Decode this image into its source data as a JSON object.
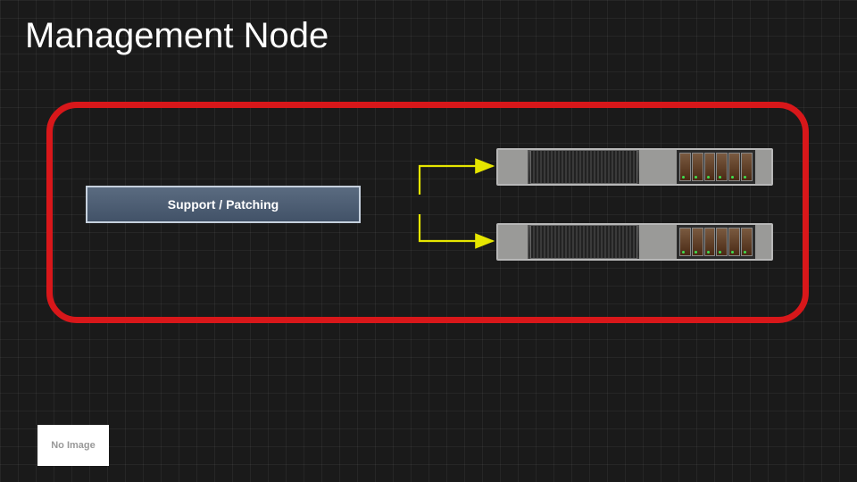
{
  "title": "Management Node",
  "box_label": "Support / Patching",
  "no_image_text": "No\nImage",
  "colors": {
    "background": "#1a1a1a",
    "border": "#d8171a",
    "box_fill_top": "#5a6b80",
    "box_fill_bottom": "#425268",
    "box_border": "#c5d0dd",
    "arrow": "#e6e600"
  }
}
